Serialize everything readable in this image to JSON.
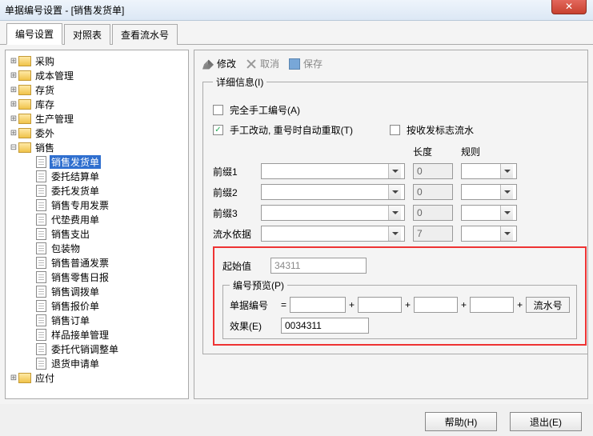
{
  "window": {
    "title": "单据编号设置 - [销售发货单]"
  },
  "tabs": [
    "编号设置",
    "对照表",
    "查看流水号"
  ],
  "toolbar": {
    "edit": "修改",
    "cancel": "取消",
    "save": "保存"
  },
  "tree": {
    "folders": [
      "采购",
      "成本管理",
      "存货",
      "库存",
      "生产管理",
      "委外",
      "销售"
    ],
    "sales_children": [
      "销售发货单",
      "委托结算单",
      "委托发货单",
      "销售专用发票",
      "代垫费用单",
      "销售支出",
      "包装物",
      "销售普通发票",
      "销售零售日报",
      "销售调拨单",
      "销售报价单",
      "销售订单",
      "样品接单管理",
      "委托代销调整单",
      "退货申请单"
    ],
    "after": [
      "应付"
    ],
    "selected": "销售发货单"
  },
  "detail": {
    "legend": "详细信息(I)",
    "chk_manual": "完全手工编号(A)",
    "chk_manual_val": false,
    "chk_auto": "手工改动, 重号时自动重取(T)",
    "chk_auto_val": true,
    "chk_sr": "按收发标志流水",
    "chk_sr_val": false,
    "col_len": "长度",
    "col_rule": "规则",
    "rows": [
      {
        "label": "前缀1",
        "len": "0",
        "rule": ""
      },
      {
        "label": "前缀2",
        "len": "0",
        "rule": ""
      },
      {
        "label": "前缀3",
        "len": "0",
        "rule": ""
      },
      {
        "label": "流水依据",
        "len": "7",
        "rule": ""
      }
    ],
    "start_label": "起始值",
    "start_value": "34311",
    "preview_legend": "编号预览(P)",
    "doc_no_label": "单据编号",
    "effect_label": "效果(E)",
    "effect_value": "0034311",
    "serial_label": "流水号"
  },
  "footer": {
    "help": "帮助(H)",
    "exit": "退出(E)"
  }
}
